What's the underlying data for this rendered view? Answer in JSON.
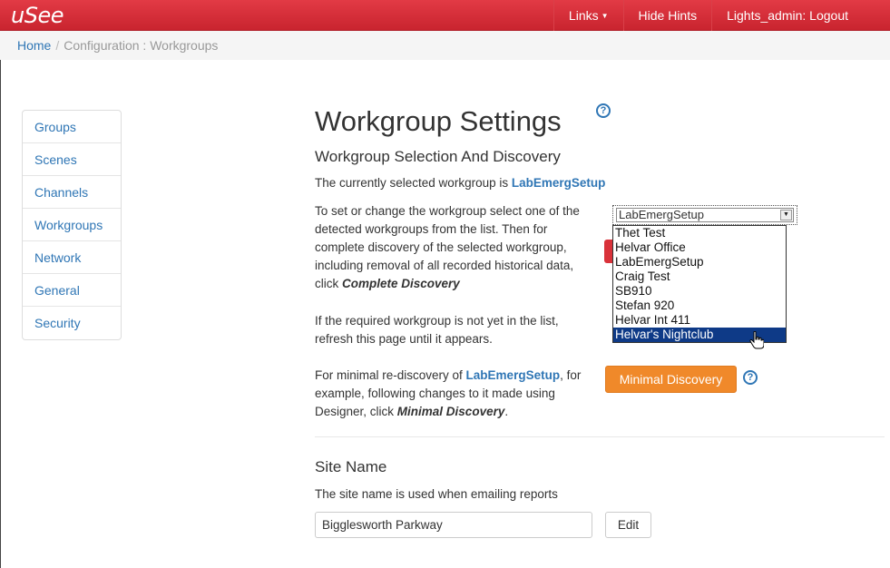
{
  "app": {
    "brand": "uSee"
  },
  "navbar": {
    "links_label": "Links",
    "hide_hints_label": "Hide Hints",
    "logout_label": "Lights_admin: Logout"
  },
  "breadcrumb": {
    "home": "Home",
    "separator": "/",
    "current": "Configuration : Workgroups"
  },
  "sidebar": {
    "items": [
      {
        "label": "Groups"
      },
      {
        "label": "Scenes"
      },
      {
        "label": "Channels"
      },
      {
        "label": "Workgroups"
      },
      {
        "label": "Network"
      },
      {
        "label": "General"
      },
      {
        "label": "Security"
      }
    ]
  },
  "main": {
    "title": "Workgroup Settings",
    "subtitle": "Workgroup Selection And Discovery",
    "current_prefix": "The currently selected workgroup is ",
    "current_workgroup": "LabEmergSetup",
    "para1_text": "To set or change the workgroup select one of the detected workgroups from the list. Then for complete discovery of the selected workgroup, including removal of all recorded historical data, click ",
    "para1_emph": "Complete Discovery",
    "para2_text": "If the required workgroup is not yet in the list, refresh this page until it appears.",
    "para3_prefix": "For minimal re-discovery of ",
    "para3_workgroup": "LabEmergSetup",
    "para3_mid": ", for example, following changes to it made using Designer, click ",
    "para3_emph": "Minimal Discovery",
    "para3_end": ".",
    "select_value": "LabEmergSetup",
    "options": [
      {
        "label": "Thet Test"
      },
      {
        "label": "Helvar Office"
      },
      {
        "label": "LabEmergSetup"
      },
      {
        "label": "Craig Test"
      },
      {
        "label": "SB910"
      },
      {
        "label": "Stefan 920"
      },
      {
        "label": "Helvar Int 411"
      },
      {
        "label": "Helvar's Nightclub"
      }
    ],
    "highlighted_option": "Helvar's Nightclub",
    "minimal_discovery_label": "Minimal Discovery"
  },
  "site": {
    "title": "Site Name",
    "description": "The site name is used when emailing reports",
    "value": "Bigglesworth Parkway",
    "edit_label": "Edit"
  },
  "colors": {
    "navbar": "#d9323a",
    "link": "#2f76b5",
    "orange_button": "#f0892a",
    "dropdown_highlight": "#0e3a87"
  }
}
